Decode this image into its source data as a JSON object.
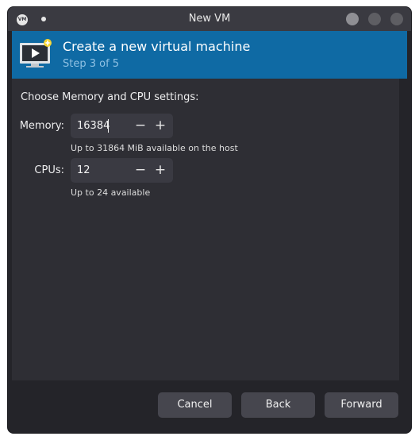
{
  "window": {
    "title": "New VM"
  },
  "header": {
    "title": "Create a new virtual machine",
    "step": "Step 3 of 5"
  },
  "form": {
    "section_label": "Choose Memory and CPU settings:",
    "memory": {
      "label": "Memory:",
      "value": "16384",
      "hint": "Up to 31864 MiB available on the host"
    },
    "cpus": {
      "label": "CPUs:",
      "value": "12",
      "hint": "Up to 24 available"
    },
    "decrement_glyph": "−",
    "increment_glyph": "+"
  },
  "footer": {
    "cancel_label": "Cancel",
    "back_label": "Back",
    "forward_label": "Forward"
  },
  "icons": {
    "app": "virt-manager-app-icon",
    "vm": "vm-screen-new-icon"
  },
  "colors": {
    "header_bg": "#0f6aa4",
    "step_text": "#8fc1e3",
    "window_bg": "#242429",
    "button_bg": "#46464e"
  }
}
